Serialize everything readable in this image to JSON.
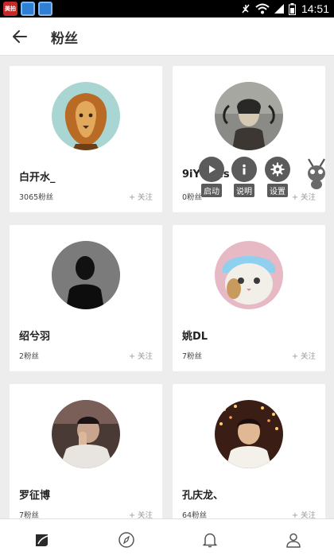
{
  "status_bar": {
    "time": "14:51",
    "app_badge_text": "美拍"
  },
  "header": {
    "title": "粉丝"
  },
  "users": [
    {
      "name": "白开水_",
      "fans": "3065粉丝",
      "follow": "+ 关注",
      "avatar": "lion"
    },
    {
      "name": "9iYtolds",
      "fans": "0粉丝",
      "follow": "+ 关注",
      "avatar": "portrait-painting"
    },
    {
      "name": "绍兮羽",
      "fans": "2粉丝",
      "follow": "+ 关注",
      "avatar": "silhouette"
    },
    {
      "name": "姚DL",
      "fans": "7粉丝",
      "follow": "+ 关注",
      "avatar": "cat"
    },
    {
      "name": "罗征博",
      "fans": "7粉丝",
      "follow": "+ 关注",
      "avatar": "person-hand"
    },
    {
      "name": "孔庆龙、",
      "fans": "64粉丝",
      "follow": "+ 关注",
      "avatar": "person-lights"
    }
  ],
  "overlay": {
    "start_label": "启动",
    "info_label": "说明",
    "settings_label": "设置"
  },
  "bottom_nav": [
    "home-icon",
    "explore-icon",
    "notifications-icon",
    "profile-icon"
  ]
}
